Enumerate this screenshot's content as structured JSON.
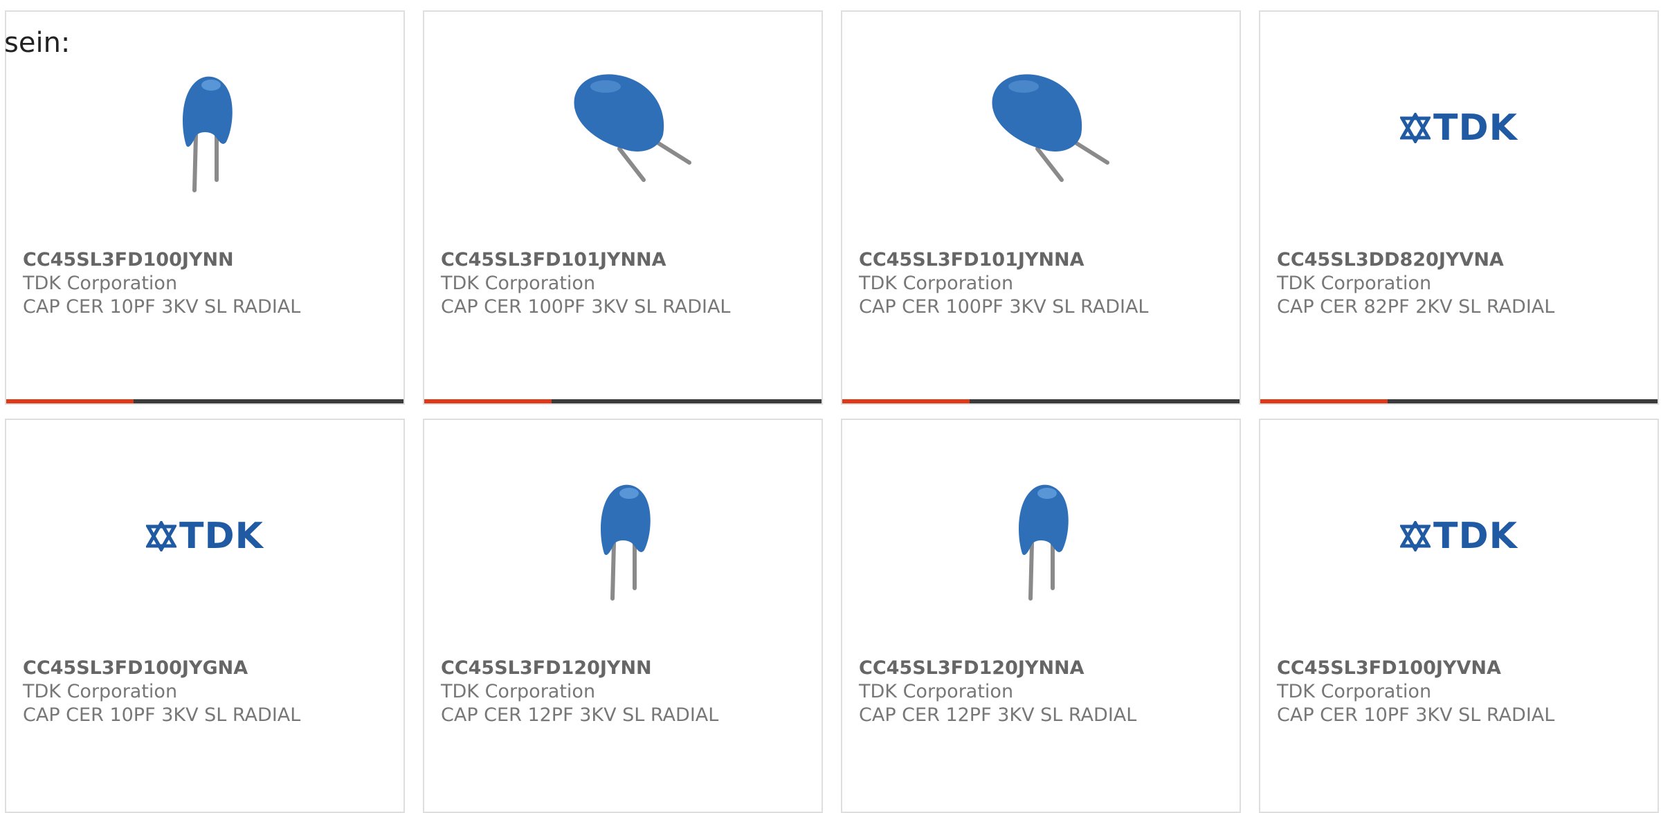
{
  "intro_text": "sein:",
  "colors": {
    "accent": "#e0391a",
    "track": "#3b3b3b",
    "capacitor_blue": "#2f6fb8",
    "tdk_blue": "#1f5aa3"
  },
  "products": [
    {
      "part_number": "CC45SL3FD100JYNN",
      "manufacturer": "TDK Corporation",
      "description": "CAP CER 10PF 3KV SL RADIAL",
      "image": "capacitor-upright",
      "progress_fraction": 0.32
    },
    {
      "part_number": "CC45SL3FD101JYNNA",
      "manufacturer": "TDK Corporation",
      "description": "CAP CER 100PF 3KV SL RADIAL",
      "image": "capacitor-angled",
      "progress_fraction": 0.32
    },
    {
      "part_number": "CC45SL3FD101JYNNA",
      "manufacturer": "TDK Corporation",
      "description": "CAP CER 100PF 3KV SL RADIAL",
      "image": "capacitor-angled",
      "progress_fraction": 0.32
    },
    {
      "part_number": "CC45SL3DD820JYVNA",
      "manufacturer": "TDK Corporation",
      "description": "CAP CER 82PF 2KV SL RADIAL",
      "image": "tdk-logo",
      "logo_text": "TDK",
      "progress_fraction": 0.32
    },
    {
      "part_number": "CC45SL3FD100JYGNA",
      "manufacturer": "TDK Corporation",
      "description": "CAP CER 10PF 3KV SL RADIAL",
      "image": "tdk-logo",
      "logo_text": "TDK",
      "progress_fraction": 0
    },
    {
      "part_number": "CC45SL3FD120JYNN",
      "manufacturer": "TDK Corporation",
      "description": "CAP CER 12PF 3KV SL RADIAL",
      "image": "capacitor-upright",
      "progress_fraction": 0
    },
    {
      "part_number": "CC45SL3FD120JYNNA",
      "manufacturer": "TDK Corporation",
      "description": "CAP CER 12PF 3KV SL RADIAL",
      "image": "capacitor-upright",
      "progress_fraction": 0
    },
    {
      "part_number": "CC45SL3FD100JYVNA",
      "manufacturer": "TDK Corporation",
      "description": "CAP CER 10PF 3KV SL RADIAL",
      "image": "tdk-logo",
      "logo_text": "TDK",
      "progress_fraction": 0
    }
  ]
}
